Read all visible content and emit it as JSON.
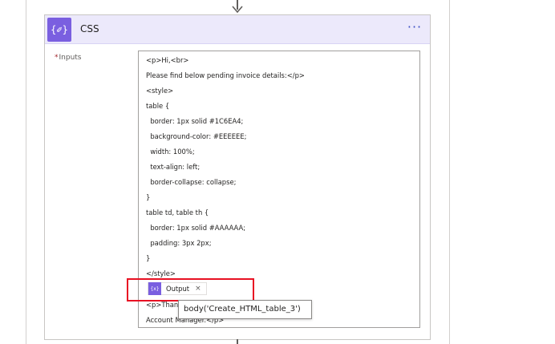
{
  "action": {
    "title": "CSS",
    "icon": "compose-icon",
    "icon_glyph": "{✐}",
    "more_label": "···",
    "accent_color": "#7a5fe0",
    "header_color": "#ece9fb"
  },
  "inputs": {
    "label": "Inputs",
    "required_mark": "*",
    "lines": [
      "<p>Hi,<br>",
      "Please find below pending invoice details:</p>",
      "<style>",
      "table {",
      "  border: 1px solid #1C6EA4;",
      "  background-color: #EEEEEE;",
      "  width: 100%;",
      "  text-align: left;",
      "  border-collapse: collapse;",
      "}",
      "table td, table th {",
      "  border: 1px solid #AAAAAA;",
      "  padding: 3px 2px;",
      "}",
      "</style>"
    ],
    "after_token_lines": [
      "<p>Than",
      "Account Manager.</p>"
    ],
    "token": {
      "icon_glyph": "{x}",
      "label": "Output",
      "close": "×"
    }
  },
  "tooltip": {
    "text": "body('Create_HTML_table_3')"
  },
  "highlight_color": "#e81123"
}
